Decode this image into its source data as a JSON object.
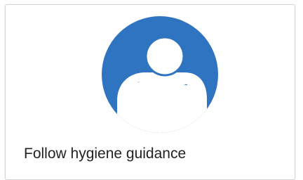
{
  "card": {
    "title": "Follow hygiene guidance",
    "icon": "cough-into-elbow-icon",
    "accent_color": "#2f74c0",
    "icon_fill": "#ffffff"
  }
}
